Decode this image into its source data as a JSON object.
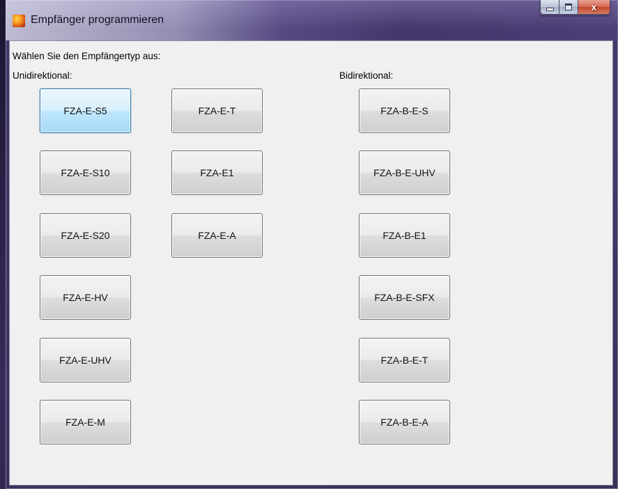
{
  "window": {
    "title": "Empfänger programmieren",
    "icon": "app-flame-icon"
  },
  "caption": {
    "minimize_icon": "minimize-icon",
    "maximize_icon": "maximize-icon",
    "close_icon": "close-icon",
    "close_glyph": "x"
  },
  "form": {
    "instruction": "Wählen Sie den Empfängertyp aus:",
    "unidirectional_label": "Unidirektional:",
    "bidirectional_label": "Bidirektional:",
    "unidirectional_col1": [
      "FZA-E-S5",
      "FZA-E-S10",
      "FZA-E-S20",
      "FZA-E-HV",
      "FZA-E-UHV",
      "FZA-E-M"
    ],
    "unidirectional_col2": [
      "FZA-E-T",
      "FZA-E1",
      "FZA-E-A"
    ],
    "bidirectional": [
      "FZA-B-E-S",
      "FZA-B-E-UHV",
      "FZA-B-E1",
      "FZA-B-E-SFX",
      "FZA-B-E-T",
      "FZA-B-E-A"
    ]
  },
  "colors": {
    "focus_border": "#3c7fb1",
    "client_background": "#f0f0f0"
  }
}
